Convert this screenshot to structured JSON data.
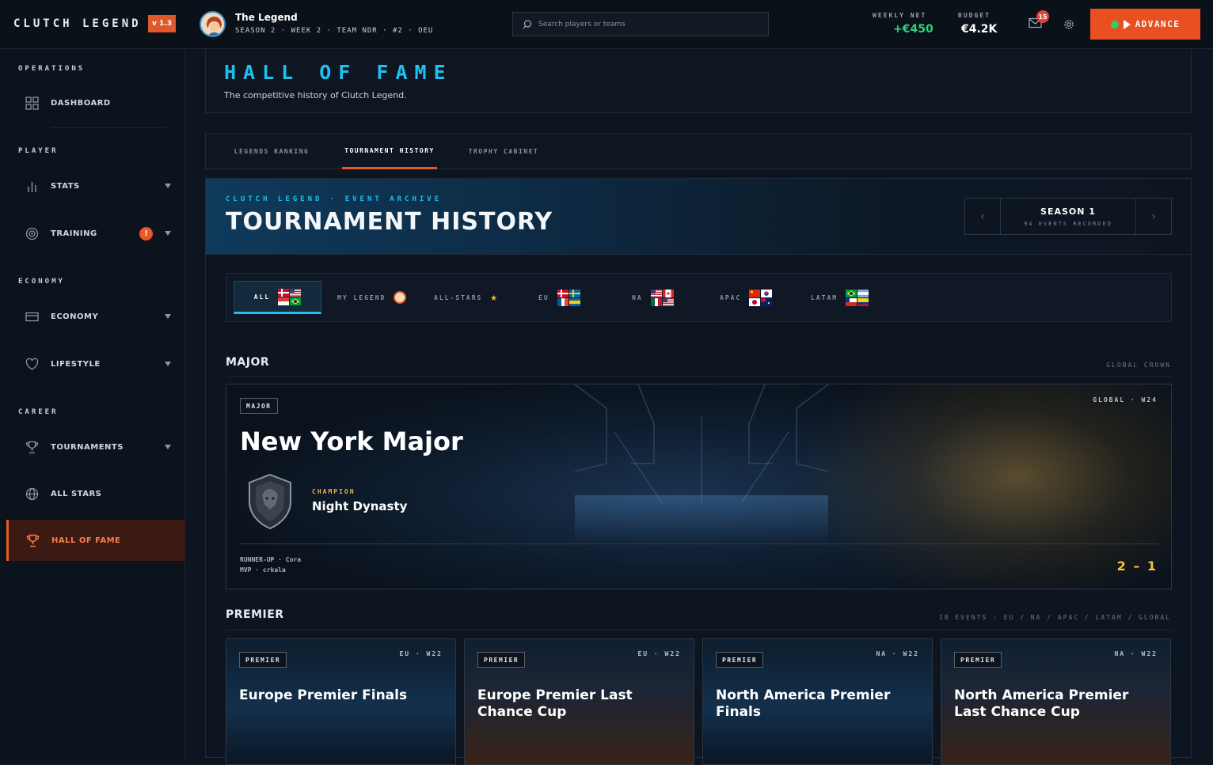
{
  "app": {
    "brand": "CLUTCH LEGEND",
    "version": "v 1.3"
  },
  "profile": {
    "name": "The Legend",
    "meta": "SEASON 2 · WEEK 2 · TEAM NDR · #2 · OEU"
  },
  "search": {
    "placeholder": "Search players or teams"
  },
  "stats": {
    "weekly_net_label": "WEEKLY NET",
    "weekly_net_value": "+€450",
    "budget_label": "BUDGET",
    "budget_value": "€4.2K"
  },
  "notifications": {
    "count": "15"
  },
  "advance": {
    "label": "ADVANCE"
  },
  "sidebar": {
    "sections": {
      "operations": "OPERATIONS",
      "player": "PLAYER",
      "economy": "ECONOMY",
      "career": "CAREER"
    },
    "items": {
      "dashboard": "DASHBOARD",
      "stats": "STATS",
      "training": "TRAINING",
      "training_alert": "!",
      "economy": "ECONOMY",
      "lifestyle": "LIFESTYLE",
      "tournaments": "TOURNAMENTS",
      "all_stars": "ALL STARS",
      "hall_of_fame": "HALL OF FAME"
    }
  },
  "page": {
    "title": "HALL OF FAME",
    "subtitle": "The competitive history of Clutch Legend."
  },
  "tabs": [
    "LEGENDS RANKING",
    "TOURNAMENT HISTORY",
    "TROPHY CABINET"
  ],
  "archive": {
    "kicker": "CLUTCH LEGEND · EVENT ARCHIVE",
    "title": "TOURNAMENT HISTORY",
    "season_title": "SEASON 1",
    "season_sub": "94 EVENTS RECORDED",
    "prev": "‹",
    "next": "›"
  },
  "filters": [
    "ALL",
    "MY LEGEND",
    "ALL-STARS",
    "EU",
    "NA",
    "APAC",
    "LATAM"
  ],
  "major_section": {
    "title": "MAJOR",
    "right": "GLOBAL CROWN"
  },
  "major": {
    "tag": "MAJOR",
    "corner": "GLOBAL · W24",
    "name": "New York Major",
    "champion_label": "CHAMPION",
    "champion": "Night Dynasty",
    "runner_up": "RUNNER-UP · Cora",
    "mvp": "MVP · crkala",
    "score": "2 – 1"
  },
  "premier_section": {
    "title": "PREMIER",
    "right": "18 EVENTS · EU / NA / APAC / LATAM / GLOBAL"
  },
  "premier": [
    {
      "tag": "PREMIER",
      "corner": "EU · W22",
      "name": "Europe Premier Finals"
    },
    {
      "tag": "PREMIER",
      "corner": "EU · W22",
      "name": "Europe Premier Last Chance Cup"
    },
    {
      "tag": "PREMIER",
      "corner": "NA · W22",
      "name": "North America Premier Finals"
    },
    {
      "tag": "PREMIER",
      "corner": "NA · W22",
      "name": "North America Premier Last Chance Cup"
    }
  ],
  "colors": {
    "accent": "#e94f20",
    "cyan": "#1ec0ef",
    "gold": "#f5c542",
    "green": "#2bd06a"
  }
}
